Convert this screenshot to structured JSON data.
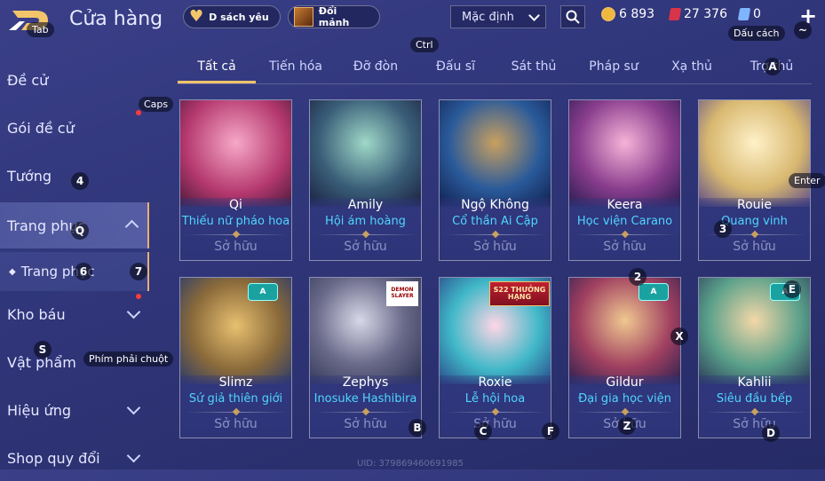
{
  "header": {
    "title": "Cửa hàng",
    "wishlist_label": "D sách yêu",
    "exchange_label": "Đổi mảnh",
    "sort_value": "Mặc định",
    "currency_gold": "6 893",
    "currency_ruby": "27 376",
    "currency_voucher": "0"
  },
  "key_hints": {
    "tab": "Tab",
    "ctrl": "Ctrl",
    "caps": "Caps",
    "space": "Dấu cách",
    "tilde": "~",
    "enter": "Enter",
    "right_click": "Phím phải chuột",
    "a": "A",
    "q": "Q",
    "s": "S",
    "b": "B",
    "c": "C",
    "f": "F",
    "x": "X",
    "z": "Z",
    "d": "D",
    "e": "E",
    "n2": "2",
    "n3": "3",
    "n4": "4",
    "n6": "6",
    "n7": "7"
  },
  "sidebar": {
    "items": [
      {
        "label": "Đề cử"
      },
      {
        "label": "Gói đề cử"
      },
      {
        "label": "Tướng"
      },
      {
        "label": "Trang phục"
      },
      {
        "label": "Kho báu"
      },
      {
        "label": "Vật phẩm"
      },
      {
        "label": "Hiệu ứng"
      },
      {
        "label": "Shop quy đổi"
      }
    ],
    "sub_item": "Trang phục"
  },
  "tabs": [
    {
      "label": "Tất cả"
    },
    {
      "label": "Tiến hóa"
    },
    {
      "label": "Đỡ đòn"
    },
    {
      "label": "Đấu sĩ"
    },
    {
      "label": "Sát thủ"
    },
    {
      "label": "Pháp sư"
    },
    {
      "label": "Xạ thủ"
    },
    {
      "label": "Trợ thủ"
    }
  ],
  "cards": [
    {
      "hero": "Qi",
      "skin": "Thiếu nữ pháo hoa",
      "status": "Sở hữu"
    },
    {
      "hero": "Amily",
      "skin": "Hội ám hoàng",
      "status": "Sở hữu"
    },
    {
      "hero": "Ngộ Không",
      "skin": "Cổ thần Ai Cập",
      "status": "Sở hữu"
    },
    {
      "hero": "Keera",
      "skin": "Học viện Carano",
      "status": "Sở hữu"
    },
    {
      "hero": "Rouie",
      "skin": "Quang vinh",
      "status": "Sở hữu"
    },
    {
      "hero": "Slimz",
      "skin": "Sứ giả thiên giới",
      "status": "Sở hữu",
      "badge": "A"
    },
    {
      "hero": "Zephys",
      "skin": "Inosuke Hashibira",
      "status": "Sở hữu",
      "badge_text": "DEMON SLAYER"
    },
    {
      "hero": "Roxie",
      "skin": "Lễ hội hoa",
      "status": "Sở hữu",
      "badge_text": "S22 THƯỞNG HẠNG"
    },
    {
      "hero": "Gildur",
      "skin": "Đại gia học viện",
      "status": "Sở hữu",
      "badge": "A"
    },
    {
      "hero": "Kahlii",
      "skin": "Siêu đầu bếp",
      "status": "Sở hữu",
      "badge": "A"
    }
  ],
  "footer": {
    "uid": "UID: 379869460691985"
  },
  "colors": {
    "accent": "#f1c36a",
    "skin_name": "#4fd5ff",
    "owned": "#8d92c4"
  }
}
